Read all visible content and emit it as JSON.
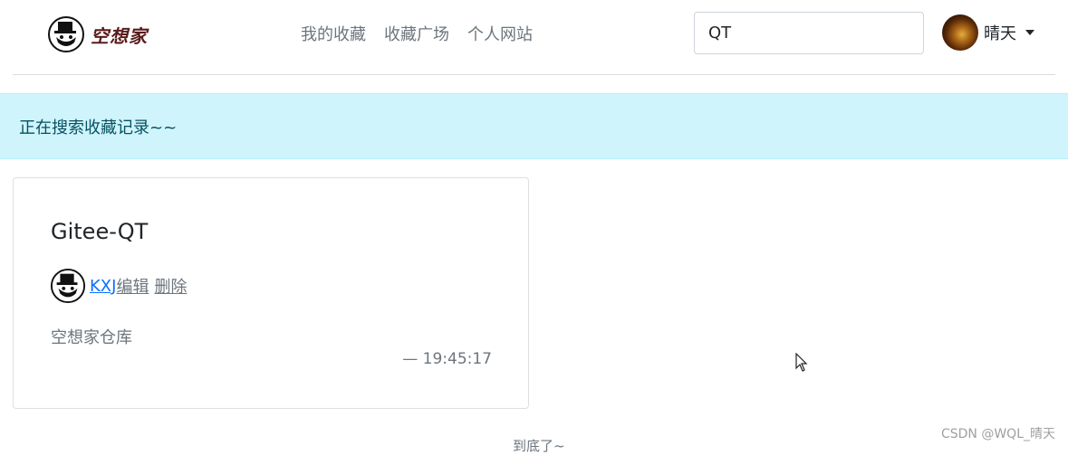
{
  "brand": {
    "name": "空想家"
  },
  "nav": {
    "links": [
      "我的收藏",
      "收藏广场",
      "个人网站"
    ]
  },
  "search": {
    "value": "QT"
  },
  "user": {
    "name": "晴天"
  },
  "alert": {
    "text": "正在搜索收藏记录~~"
  },
  "card": {
    "title": "Gitee-QT",
    "author": " KXJ ",
    "edit_label": "编辑",
    "delete_label": "删除",
    "description": "空想家仓库",
    "time": "—  19:45:17"
  },
  "footer": {
    "end_text": "到底了~"
  },
  "watermark": "CSDN @WQL_晴天",
  "colors": {
    "alert_bg": "#cff4fc",
    "link": "#0d6efd",
    "muted": "#6c757d"
  }
}
